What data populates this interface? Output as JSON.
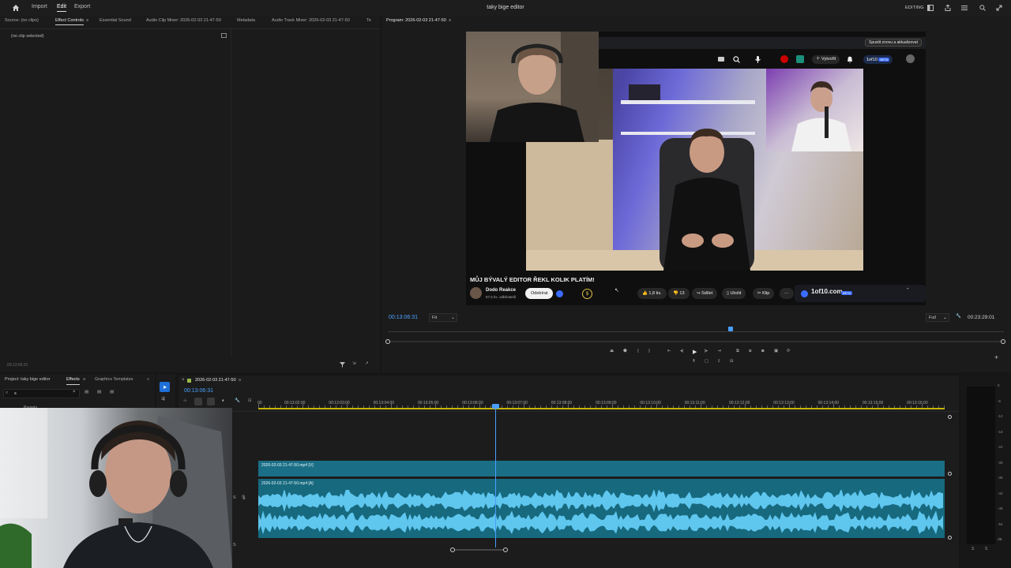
{
  "app": {
    "title": "taky bige editor",
    "menus": [
      "Import",
      "Edit",
      "Export"
    ],
    "active_menu": "Edit",
    "workspace": "EDITING"
  },
  "source_panel": {
    "tabs": [
      "Source: (no clips)",
      "Effect Controls",
      "Essential Sound",
      "Audio Clip Mixer: 2026-02-03 21-47-50",
      "Metadata",
      "Audio Track Mixer: 2026-02-03 21-47-50",
      "Te"
    ],
    "active_tab": "Effect Controls",
    "no_clip_text": "(no clip selected)",
    "timecode": "00:13:06:31"
  },
  "program": {
    "tab": "Program: 2026-02-03 21-47-50",
    "timecode": "00:13:06:31",
    "fit_select": "Fit",
    "quality_select": "Full",
    "duration": "00:23:29:01"
  },
  "youtube": {
    "update_button": "Spustit znovu a aktualizovat",
    "create_button": "Vytvořit",
    "oneof_badge": "1of10",
    "beta": "BETA",
    "video_title": "MŮJ BÝVALÝ EDITOR ŘEKL KOLIK PLATÍM!",
    "channel_name": "Dodo Reakce",
    "channel_subs": "87,5 tis. odběratelů",
    "subscribe_button": "Odebírat",
    "likes": "1,8 tis.",
    "dislikes": "13",
    "share": "Sdílet",
    "save": "Uložit",
    "clip": "Klip",
    "oneof_link": "1of10.com"
  },
  "project_panel": {
    "title": "Project: taky bige editor",
    "tabs": [
      "Effects",
      "Graphics Templates"
    ],
    "active_tab": "Effects",
    "search_value": "s",
    "tree_item": "Presets"
  },
  "timeline": {
    "sequence_name": "2026-02-03 21-47-50",
    "timecode": "00:13:06:31",
    "ruler": [
      "00",
      "00:13:02:00",
      "00:13:03:00",
      "00:13:04:00",
      "00:13:05:00",
      "00:13:06:00",
      "00:13:07:00",
      "00:13:08:00",
      "00:13:09:00",
      "00:13:10:00",
      "00:13:11:00",
      "00:13:12:00",
      "00:13:13:00",
      "00:13:14:00",
      "00:13:15:00",
      "00:13:16:00"
    ],
    "video_clip": "2026-02-03 21-47-50.mp4 [V]",
    "audio_clip": "2026-02-03 21-47-50.mp4 [A]",
    "track_labels": [
      "S",
      "S"
    ]
  },
  "meter": {
    "scale": [
      "0",
      "-6",
      "-12",
      "-18",
      "-24",
      "-30",
      "-36",
      "-42",
      "-48",
      "-54",
      "dB"
    ],
    "channels": [
      "S",
      "S"
    ]
  },
  "colors": {
    "accent": "#4a9eff",
    "clip_video": "#1a6f86",
    "clip_audio": "#17697e",
    "waveform": "#5fc6ee"
  }
}
